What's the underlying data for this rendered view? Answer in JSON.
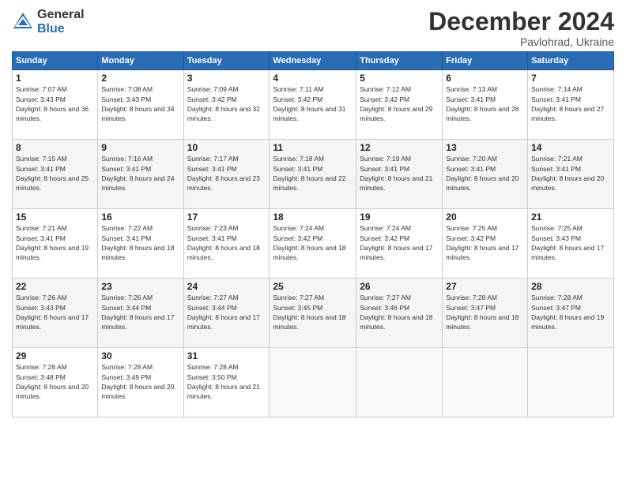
{
  "header": {
    "logo_general": "General",
    "logo_blue": "Blue",
    "month_title": "December 2024",
    "location": "Pavlohrad, Ukraine"
  },
  "days_of_week": [
    "Sunday",
    "Monday",
    "Tuesday",
    "Wednesday",
    "Thursday",
    "Friday",
    "Saturday"
  ],
  "weeks": [
    [
      {
        "day": "1",
        "sunrise": "7:07 AM",
        "sunset": "3:43 PM",
        "daylight": "8 hours and 36 minutes."
      },
      {
        "day": "2",
        "sunrise": "7:08 AM",
        "sunset": "3:43 PM",
        "daylight": "8 hours and 34 minutes."
      },
      {
        "day": "3",
        "sunrise": "7:09 AM",
        "sunset": "3:42 PM",
        "daylight": "8 hours and 32 minutes."
      },
      {
        "day": "4",
        "sunrise": "7:11 AM",
        "sunset": "3:42 PM",
        "daylight": "8 hours and 31 minutes."
      },
      {
        "day": "5",
        "sunrise": "7:12 AM",
        "sunset": "3:42 PM",
        "daylight": "8 hours and 29 minutes."
      },
      {
        "day": "6",
        "sunrise": "7:13 AM",
        "sunset": "3:41 PM",
        "daylight": "8 hours and 28 minutes."
      },
      {
        "day": "7",
        "sunrise": "7:14 AM",
        "sunset": "3:41 PM",
        "daylight": "8 hours and 27 minutes."
      }
    ],
    [
      {
        "day": "8",
        "sunrise": "7:15 AM",
        "sunset": "3:41 PM",
        "daylight": "8 hours and 25 minutes."
      },
      {
        "day": "9",
        "sunrise": "7:16 AM",
        "sunset": "3:41 PM",
        "daylight": "8 hours and 24 minutes."
      },
      {
        "day": "10",
        "sunrise": "7:17 AM",
        "sunset": "3:41 PM",
        "daylight": "8 hours and 23 minutes."
      },
      {
        "day": "11",
        "sunrise": "7:18 AM",
        "sunset": "3:41 PM",
        "daylight": "8 hours and 22 minutes."
      },
      {
        "day": "12",
        "sunrise": "7:19 AM",
        "sunset": "3:41 PM",
        "daylight": "8 hours and 21 minutes."
      },
      {
        "day": "13",
        "sunrise": "7:20 AM",
        "sunset": "3:41 PM",
        "daylight": "8 hours and 20 minutes."
      },
      {
        "day": "14",
        "sunrise": "7:21 AM",
        "sunset": "3:41 PM",
        "daylight": "8 hours and 20 minutes."
      }
    ],
    [
      {
        "day": "15",
        "sunrise": "7:21 AM",
        "sunset": "3:41 PM",
        "daylight": "8 hours and 19 minutes."
      },
      {
        "day": "16",
        "sunrise": "7:22 AM",
        "sunset": "3:41 PM",
        "daylight": "8 hours and 18 minutes."
      },
      {
        "day": "17",
        "sunrise": "7:23 AM",
        "sunset": "3:41 PM",
        "daylight": "8 hours and 18 minutes."
      },
      {
        "day": "18",
        "sunrise": "7:24 AM",
        "sunset": "3:42 PM",
        "daylight": "8 hours and 18 minutes."
      },
      {
        "day": "19",
        "sunrise": "7:24 AM",
        "sunset": "3:42 PM",
        "daylight": "8 hours and 17 minutes."
      },
      {
        "day": "20",
        "sunrise": "7:25 AM",
        "sunset": "3:42 PM",
        "daylight": "8 hours and 17 minutes."
      },
      {
        "day": "21",
        "sunrise": "7:25 AM",
        "sunset": "3:43 PM",
        "daylight": "8 hours and 17 minutes."
      }
    ],
    [
      {
        "day": "22",
        "sunrise": "7:26 AM",
        "sunset": "3:43 PM",
        "daylight": "8 hours and 17 minutes."
      },
      {
        "day": "23",
        "sunrise": "7:26 AM",
        "sunset": "3:44 PM",
        "daylight": "8 hours and 17 minutes."
      },
      {
        "day": "24",
        "sunrise": "7:27 AM",
        "sunset": "3:44 PM",
        "daylight": "8 hours and 17 minutes."
      },
      {
        "day": "25",
        "sunrise": "7:27 AM",
        "sunset": "3:45 PM",
        "daylight": "8 hours and 18 minutes."
      },
      {
        "day": "26",
        "sunrise": "7:27 AM",
        "sunset": "3:46 PM",
        "daylight": "8 hours and 18 minutes."
      },
      {
        "day": "27",
        "sunrise": "7:28 AM",
        "sunset": "3:47 PM",
        "daylight": "8 hours and 18 minutes."
      },
      {
        "day": "28",
        "sunrise": "7:28 AM",
        "sunset": "3:47 PM",
        "daylight": "8 hours and 19 minutes."
      }
    ],
    [
      {
        "day": "29",
        "sunrise": "7:28 AM",
        "sunset": "3:48 PM",
        "daylight": "8 hours and 20 minutes."
      },
      {
        "day": "30",
        "sunrise": "7:28 AM",
        "sunset": "3:49 PM",
        "daylight": "8 hours and 20 minutes."
      },
      {
        "day": "31",
        "sunrise": "7:28 AM",
        "sunset": "3:50 PM",
        "daylight": "8 hours and 21 minutes."
      },
      null,
      null,
      null,
      null
    ]
  ]
}
